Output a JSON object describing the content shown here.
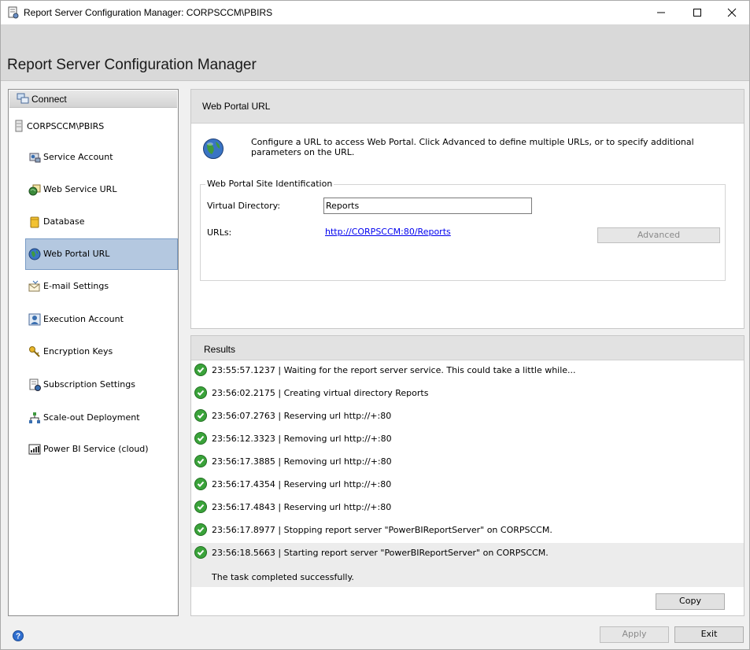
{
  "window": {
    "title": "Report Server Configuration Manager: CORPSCCM\\PBIRS",
    "app_title": "Report Server Configuration Manager"
  },
  "sidebar": {
    "connect_label": "Connect",
    "server": "CORPSCCM\\PBIRS",
    "items": [
      {
        "label": "Service Account",
        "icon": "service-account-icon"
      },
      {
        "label": "Web Service URL",
        "icon": "web-service-icon"
      },
      {
        "label": "Database",
        "icon": "database-icon"
      },
      {
        "label": "Web Portal URL",
        "icon": "globe-icon",
        "selected": true
      },
      {
        "label": "E-mail Settings",
        "icon": "email-icon"
      },
      {
        "label": "Execution Account",
        "icon": "execution-account-icon"
      },
      {
        "label": "Encryption Keys",
        "icon": "keys-icon"
      },
      {
        "label": "Subscription Settings",
        "icon": "subscription-icon"
      },
      {
        "label": "Scale-out Deployment",
        "icon": "scaleout-icon"
      },
      {
        "label": "Power BI Service (cloud)",
        "icon": "powerbi-icon"
      }
    ]
  },
  "panel": {
    "title": "Web Portal URL",
    "description": "Configure a URL to access Web Portal.  Click Advanced to define multiple URLs, or to specify additional parameters on the URL.",
    "group_title": "Web Portal Site Identification",
    "virtual_directory_label": "Virtual Directory:",
    "virtual_directory_value": "Reports",
    "urls_label": "URLs:",
    "url": "http://CORPSCCM:80/Reports",
    "advanced_label": "Advanced"
  },
  "results": {
    "title": "Results",
    "rows": [
      "23:55:57.1237 | Waiting for the report server service. This could take a little while...",
      "23:56:02.2175 | Creating virtual directory Reports",
      "23:56:07.2763 | Reserving url http://+:80",
      "23:56:12.3323 | Removing url http://+:80",
      "23:56:17.3885 | Removing url http://+:80",
      "23:56:17.4354 | Reserving url http://+:80",
      "23:56:17.4843 | Reserving url http://+:80",
      "23:56:17.8977 | Stopping report server \"PowerBIReportServer\" on CORPSCCM.",
      "23:56:18.5663 | Starting report server \"PowerBIReportServer\" on CORPSCCM."
    ],
    "completion": "The task completed successfully.",
    "copy_label": "Copy"
  },
  "footer": {
    "apply_label": "Apply",
    "exit_label": "Exit"
  }
}
